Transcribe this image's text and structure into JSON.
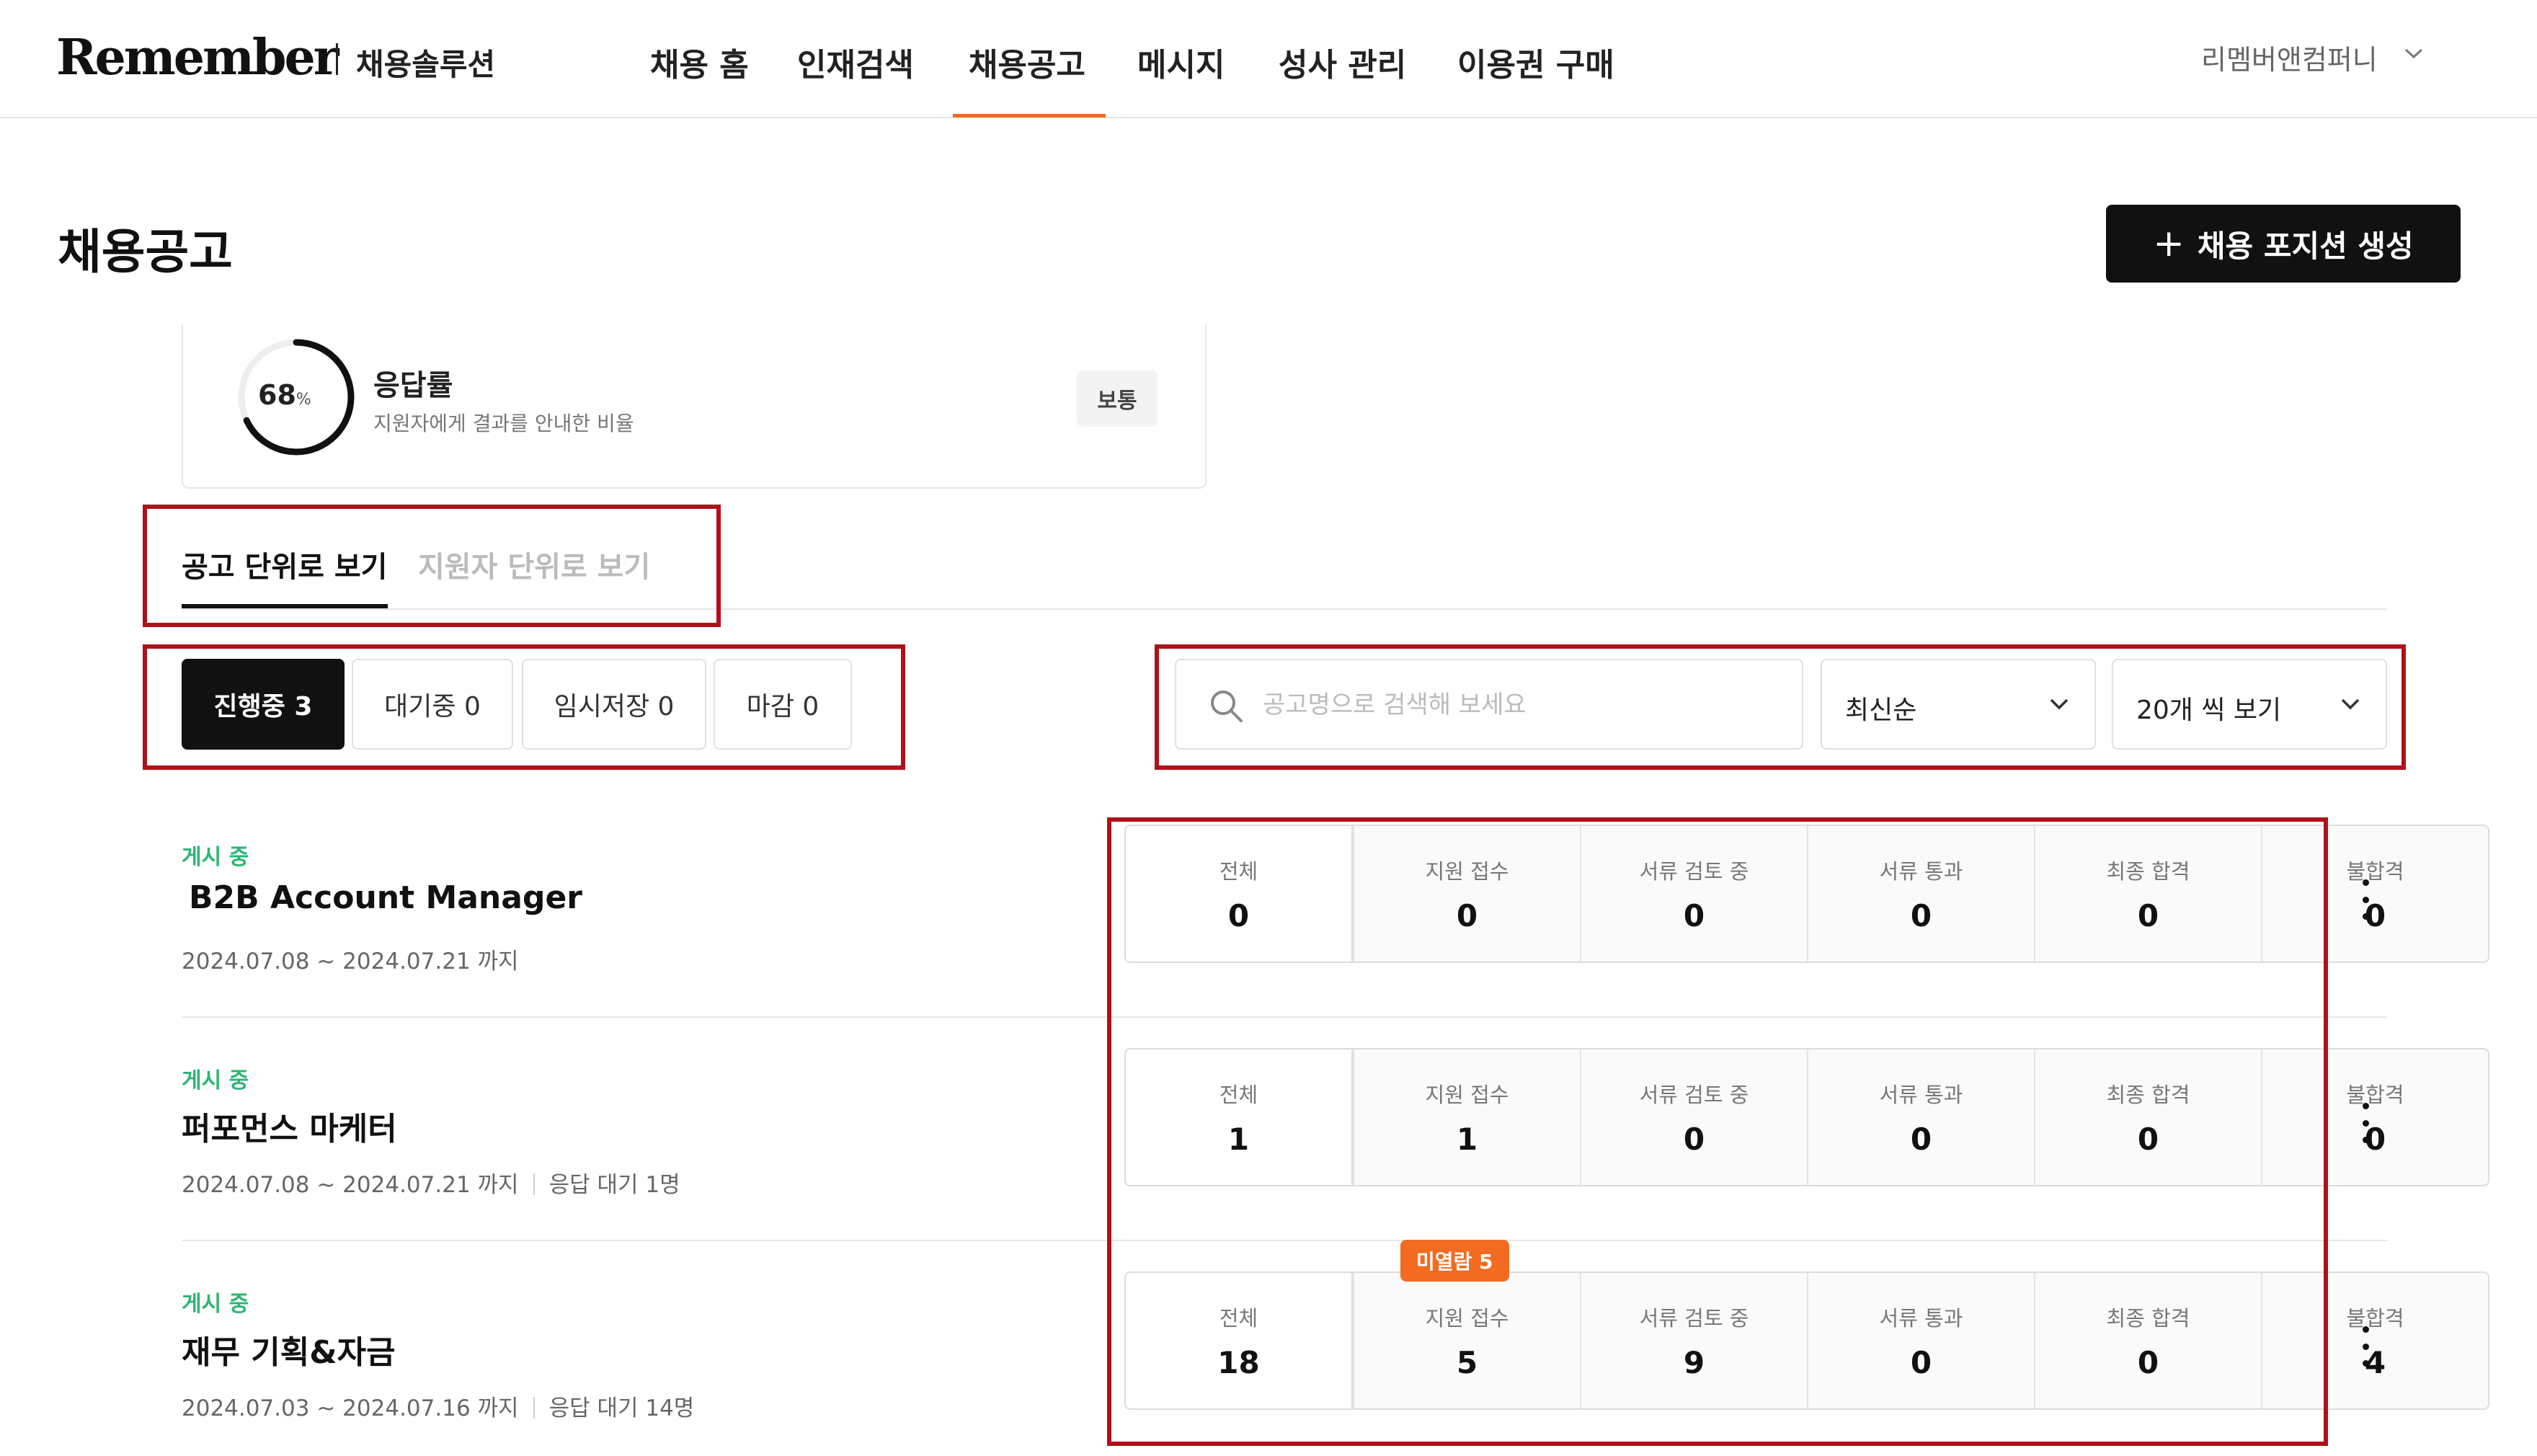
{
  "brand": {
    "logo": "Remember",
    "subtitle": "채용솔루션"
  },
  "nav": {
    "items": [
      {
        "label": "채용 홈"
      },
      {
        "label": "인재검색"
      },
      {
        "label": "채용공고",
        "active": true
      },
      {
        "label": "메시지"
      },
      {
        "label": "성사 관리"
      },
      {
        "label": "이용권 구매"
      }
    ],
    "company": "리멤버앤컴퍼니"
  },
  "header": {
    "title": "채용공고",
    "create_button": "채용 포지션 생성"
  },
  "response": {
    "percent": "68",
    "percent_unit": "%",
    "rate": 0.68,
    "title": "응답률",
    "description": "지원자에게 결과를 안내한 비율",
    "badge": "보통"
  },
  "view_tabs": [
    {
      "label": "공고 단위로 보기",
      "active": true
    },
    {
      "label": "지원자 단위로 보기",
      "active": false
    }
  ],
  "status_filters": [
    {
      "label": "진행중 3",
      "active": true
    },
    {
      "label": "대기중 0",
      "active": false
    },
    {
      "label": "임시저장 0",
      "active": false
    },
    {
      "label": "마감 0",
      "active": false
    }
  ],
  "search": {
    "placeholder": "공고명으로 검색해 보세요",
    "value": ""
  },
  "sort": {
    "selected": "최신순"
  },
  "page_size": {
    "selected": "20개 씩 보기"
  },
  "stat_labels": [
    "전체",
    "지원 접수",
    "서류 검토 중",
    "서류 통과",
    "최종 합격",
    "불합격"
  ],
  "jobs": [
    {
      "status": "게시 중",
      "title": "B2B Account Manager",
      "period": "2024.07.08 ~ 2024.07.21 까지",
      "pending": "",
      "unread_badge": "",
      "stats": [
        "0",
        "0",
        "0",
        "0",
        "0",
        "0"
      ]
    },
    {
      "status": "게시 중",
      "title": "퍼포먼스 마케터",
      "period": "2024.07.08 ~ 2024.07.21 까지",
      "pending": "응답 대기 1명",
      "unread_badge": "",
      "stats": [
        "1",
        "1",
        "0",
        "0",
        "0",
        "0"
      ]
    },
    {
      "status": "게시 중",
      "title": "재무 기획&자금",
      "period": "2024.07.03 ~ 2024.07.16 까지",
      "pending": "응답 대기 14명",
      "unread_badge": "미열람 5",
      "stats": [
        "18",
        "5",
        "9",
        "0",
        "0",
        "4"
      ]
    }
  ],
  "colors": {
    "accent": "#f26b21",
    "live_status": "#2bb673",
    "annotation": "#b01119",
    "primary_button": "#111111"
  }
}
